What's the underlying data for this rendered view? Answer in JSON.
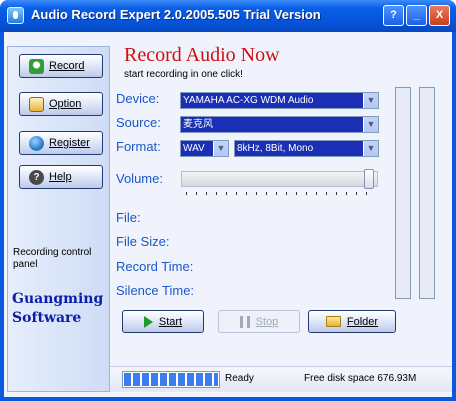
{
  "window": {
    "title": "Audio Record Expert 2.0.2005.505 Trial Version",
    "help_glyph": "?",
    "minimize_glyph": "_",
    "close_glyph": "X"
  },
  "sidebar": {
    "buttons": [
      {
        "label": "Record",
        "icon": "microphone-icon",
        "color": "#2f9e3a"
      },
      {
        "label": "Option",
        "icon": "settings-icon",
        "color": "#e7b43a"
      },
      {
        "label": "Register",
        "icon": "globe-icon",
        "color": "#2b7bd1"
      },
      {
        "label": "Help",
        "icon": "help-icon",
        "color": "#4a4a4a"
      }
    ],
    "description": "Recording control panel",
    "brand_line1": "Guangming",
    "brand_line2": "Software"
  },
  "main": {
    "heading": "Record Audio Now",
    "subheading": "start recording in one click!",
    "device_label": "Device:",
    "device_value": "YAMAHA AC-XG WDM Audio",
    "source_label": "Source:",
    "source_value": "麦克风",
    "format_label": "Format:",
    "format_value": "WAV",
    "format_detail_value": "8kHz, 8Bit, Mono",
    "volume_label": "Volume:",
    "volume_level": 0.98,
    "file_label": "File:",
    "file_size_label": "File Size:",
    "record_time_label": "Record Time:",
    "silence_time_label": "Silence Time:"
  },
  "actions": {
    "start_label": "Start",
    "stop_label": "Stop",
    "folder_label": "Folder"
  },
  "status": {
    "progress": 1.0,
    "state": "Ready",
    "disk_space": "Free disk space 676.93M"
  },
  "colors": {
    "label_blue": "#1a57c8",
    "heading_red": "#d01010",
    "brand_blue": "#0a1ea8",
    "combo_bg": "#1a2fb5"
  }
}
